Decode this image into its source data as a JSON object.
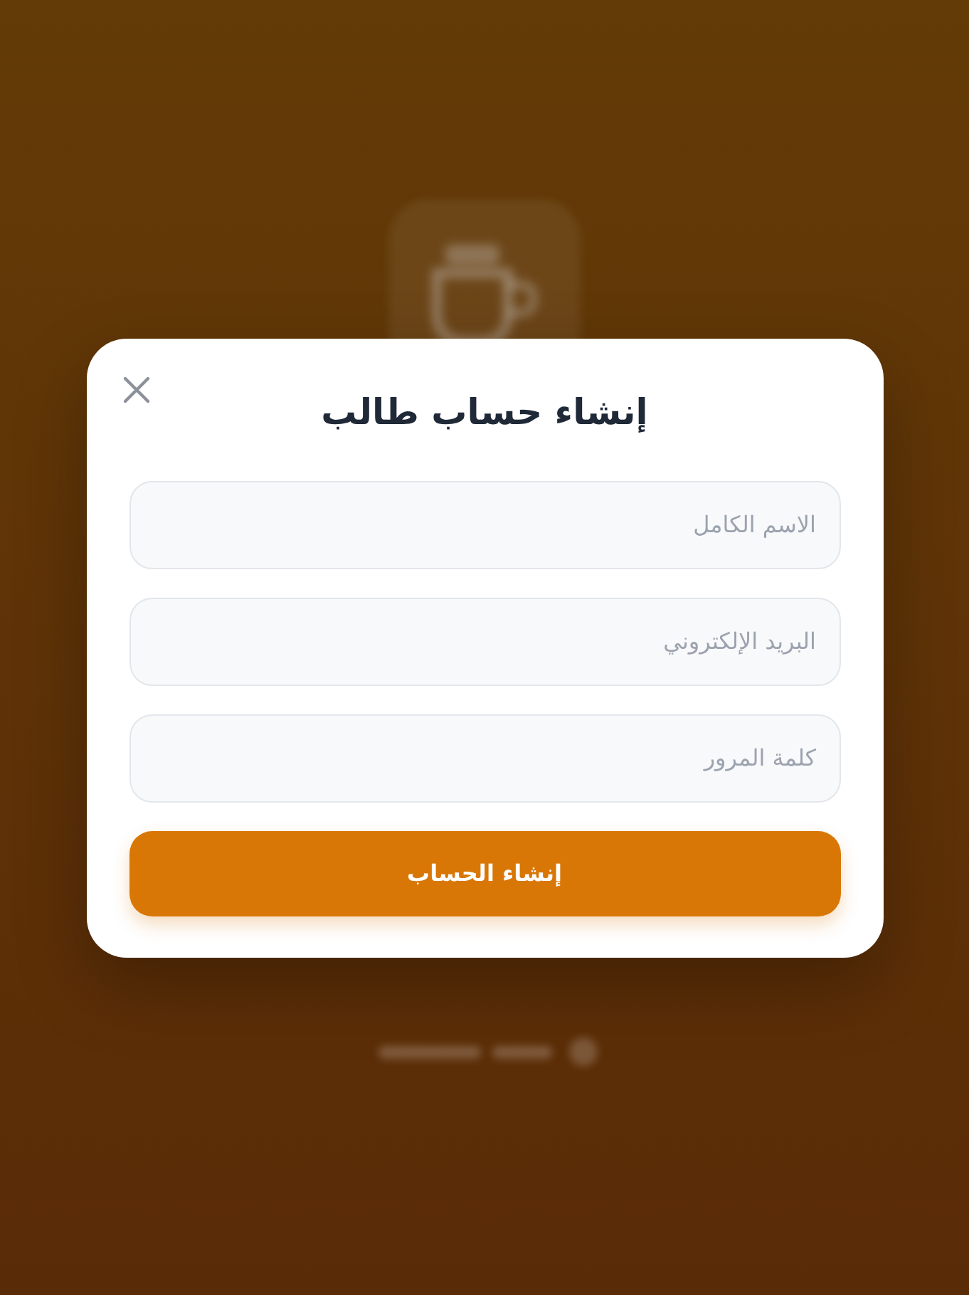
{
  "dialog": {
    "title": "إنشاء حساب طالب",
    "fields": [
      {
        "placeholder": "الاسم الكامل"
      },
      {
        "placeholder": "البريد الإلكتروني"
      },
      {
        "placeholder": "كلمة المرور"
      }
    ],
    "submit_button": "إنشاء الحساب"
  }
}
